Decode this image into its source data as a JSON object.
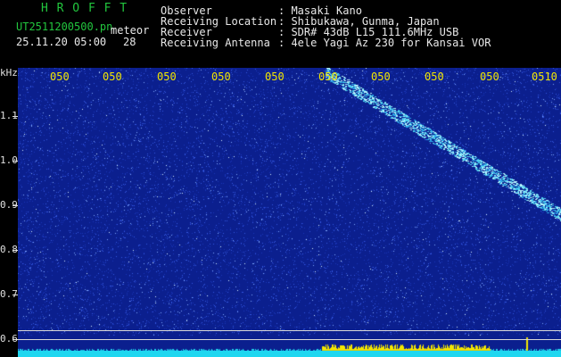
{
  "header": {
    "logo": "H R O F F T",
    "filename": "UT2511200500.pn",
    "mode": "meteor",
    "datetime": "25.11.20 05:00",
    "count": "28",
    "fields": [
      {
        "label": "Observer",
        "value": ": Masaki Kano"
      },
      {
        "label": "Receiving Location",
        "value": ": Shibukawa, Gunma, Japan"
      },
      {
        "label": "Receiver",
        "value": ": SDR# 43dB L15 111.6MHz USB"
      },
      {
        "label": "Receiving Antenna",
        "value": ": 4ele Yagi Az 230 for Kansai VOR"
      }
    ]
  },
  "axis": {
    "y_unit": "kHz",
    "y_ticks": [
      "1.1",
      "1.0",
      "0.9",
      "0.8",
      "0.7",
      "0.6"
    ],
    "x_ticks": [
      "050",
      "050",
      "050",
      "050",
      "050",
      "050",
      "050",
      "050",
      "050",
      "0510"
    ]
  },
  "colors": {
    "background": "#0b1f8e",
    "noise": "#4f7cff",
    "meteor": "#7fe8ff",
    "signal_bar": "#1fd7f0",
    "signal_peak": "#f2e600"
  }
}
